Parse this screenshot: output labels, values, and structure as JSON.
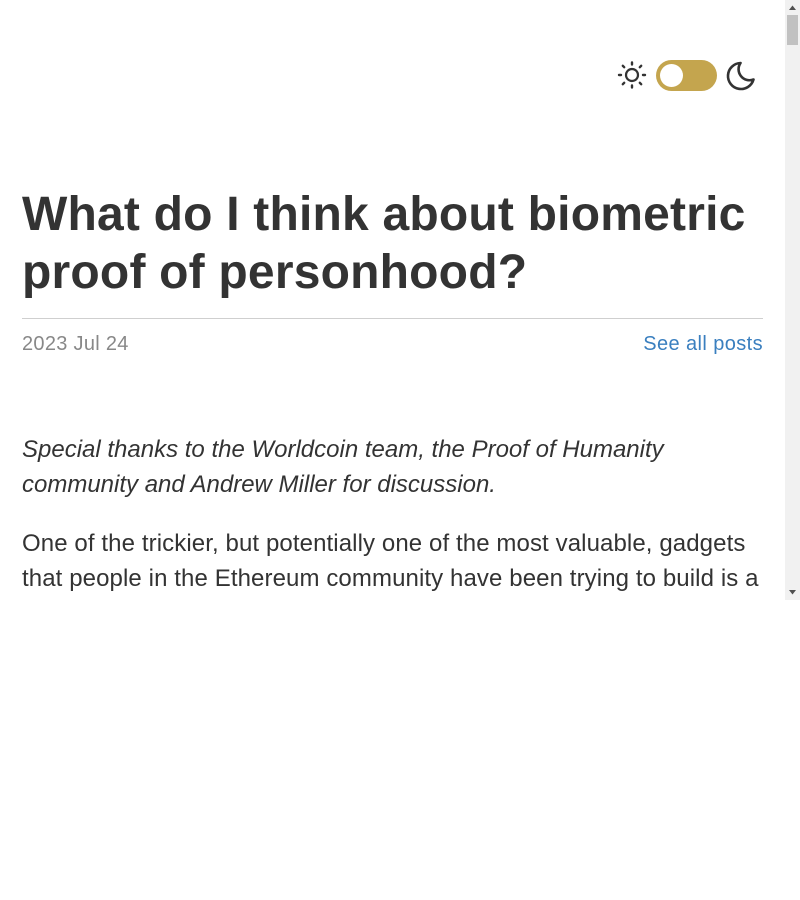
{
  "theme_toggle": {
    "light_icon": "sun-icon",
    "dark_icon": "moon-icon",
    "switch_color": "#c4a54e",
    "state": "light"
  },
  "post": {
    "title": "What do I think about biometric proof of personhood?",
    "date": "2023 Jul 24",
    "see_all_label": "See all posts",
    "thanks": "Special thanks to the Worldcoin team, the Proof of Humanity community and Andrew Miller for discussion.",
    "intro": "One of the trickier, but potentially one of the most valuable, gadgets that people in the Ethereum community have been trying to build is a"
  },
  "colors": {
    "text": "#333333",
    "date": "#888888",
    "link": "#3a7fbf"
  }
}
